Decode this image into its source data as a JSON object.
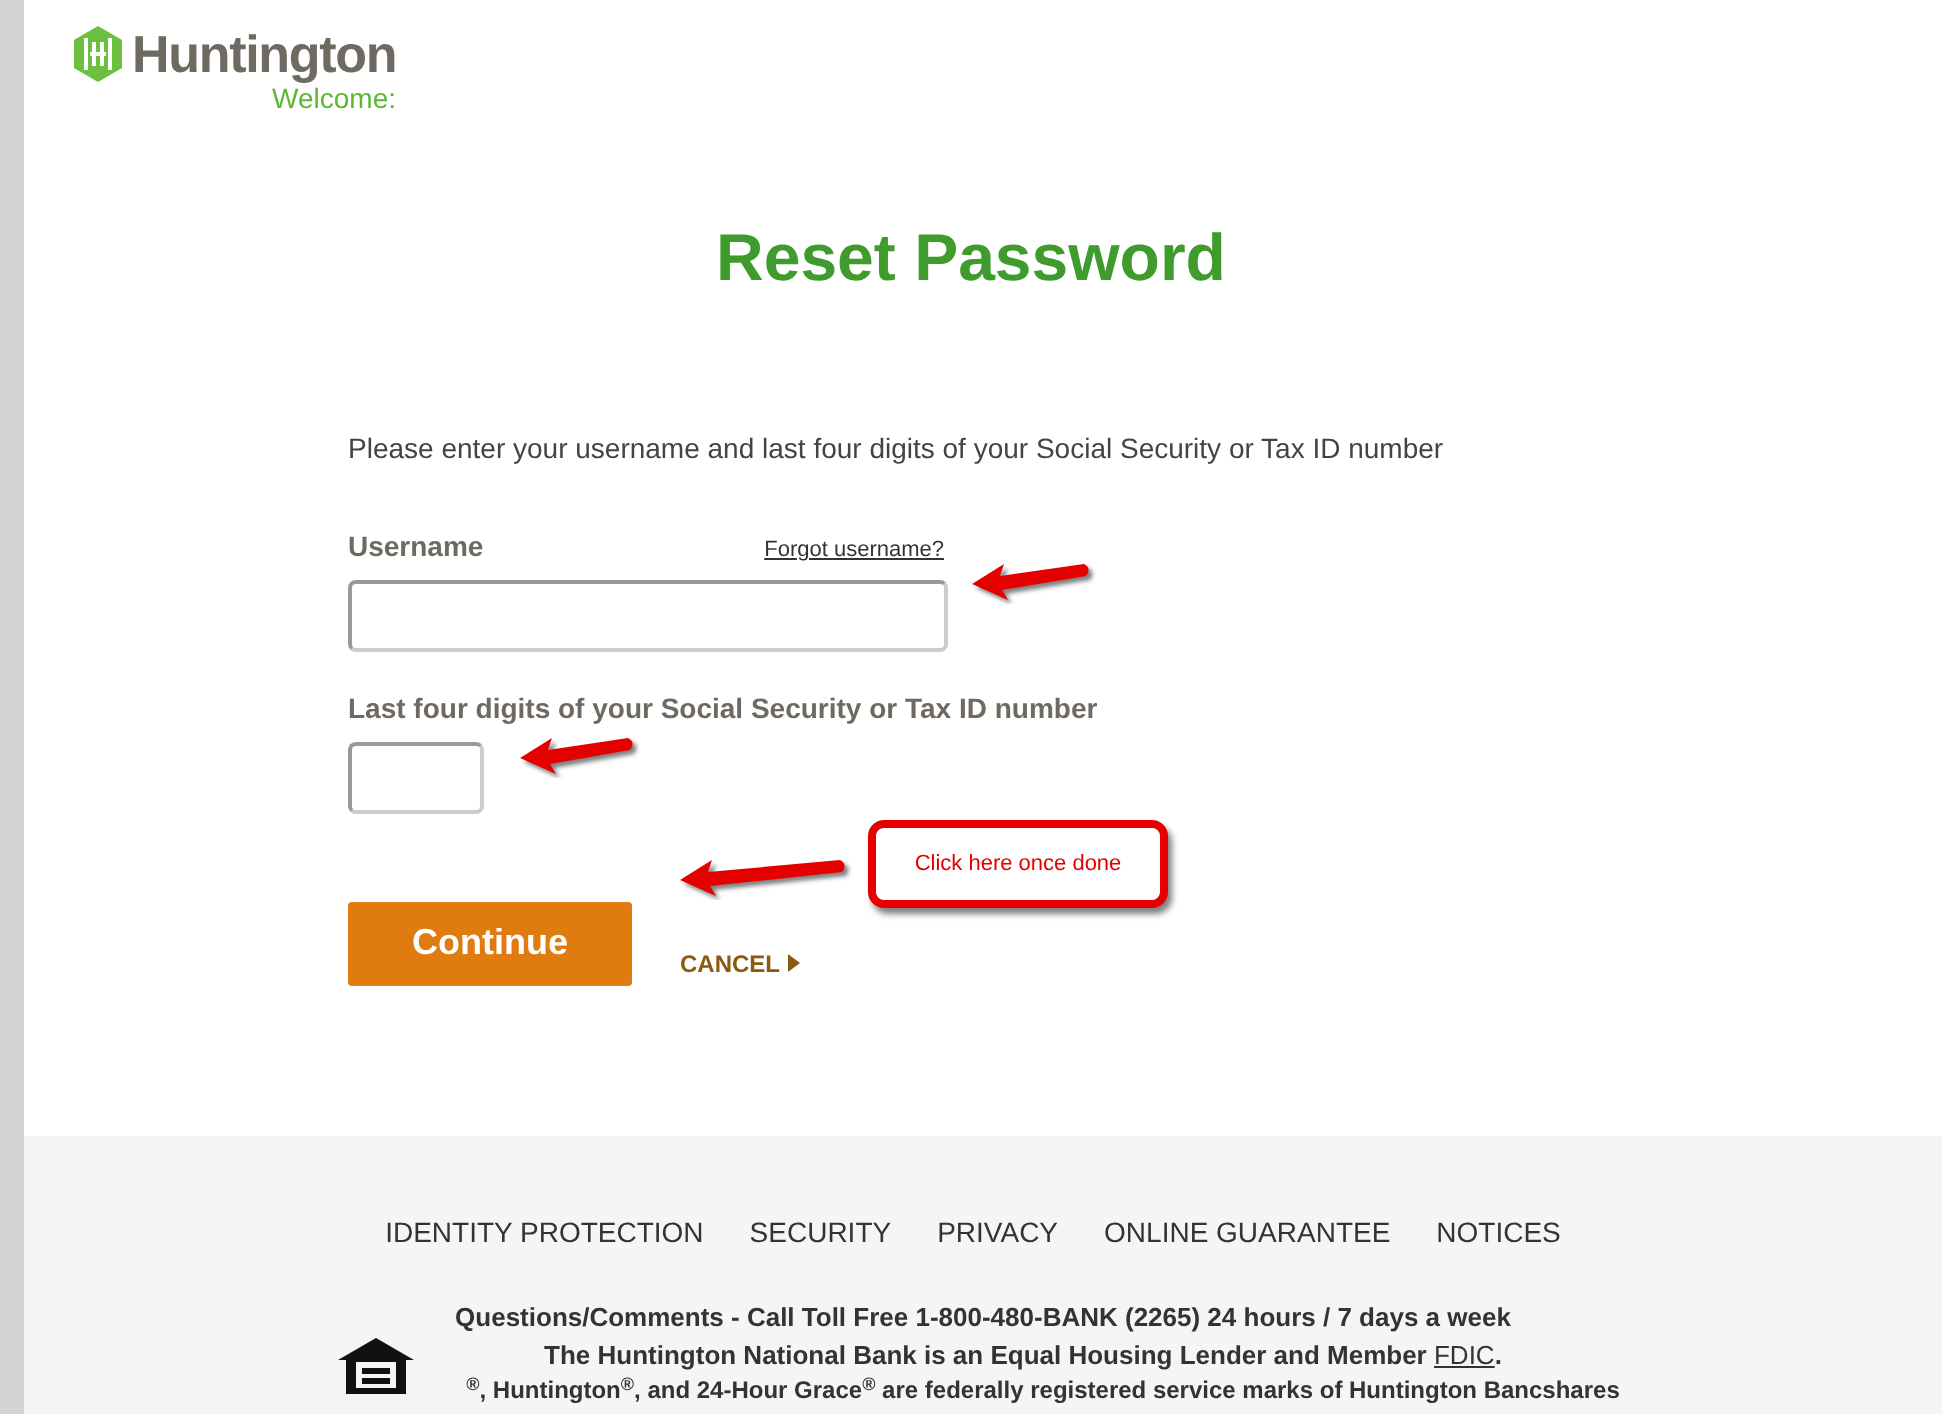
{
  "header": {
    "brand": "Huntington",
    "tagline": "Welcome:"
  },
  "title": "Reset Password",
  "instructions": "Please enter your username and last four digits of your Social Security or Tax ID number",
  "username": {
    "label": "Username",
    "link": "Forgot username?"
  },
  "ssn": {
    "label": "Last four digits of your Social Security or Tax ID number"
  },
  "buttons": {
    "continue": "Continue",
    "cancel": "CANCEL"
  },
  "callout": "Click here once done",
  "footer": {
    "links": [
      "IDENTITY PROTECTION",
      "SECURITY",
      "PRIVACY",
      "ONLINE GUARANTEE",
      "NOTICES"
    ],
    "contact": "Questions/Comments - Call Toll Free 1-800-480-BANK (2265) 24 hours / 7 days a week",
    "lender": "The Huntington National Bank is an Equal Housing Lender and Member",
    "lender_link": "FDIC",
    "lender_end": ".",
    "marks": "$^{®}$, Huntington$^{®}$, and 24-Hour Grace$^{®}$ are federally registered service marks of Huntington Bancshares"
  }
}
